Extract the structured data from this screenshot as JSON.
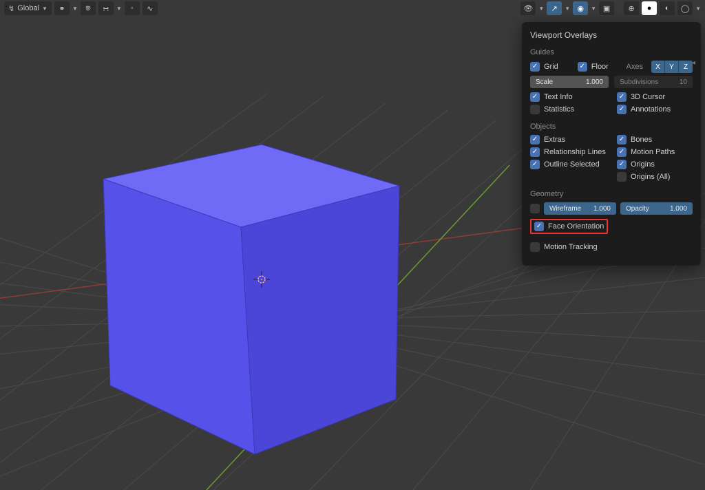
{
  "header": {
    "orientation_label": "Global",
    "snap_icons": [
      "link-icon",
      "magnet-icon",
      "proportional-icon",
      "pivot-icon",
      "curve-icon"
    ]
  },
  "header_right": {
    "buttons": [
      "visibility-icon",
      "gizmo-icon",
      "overlays-icon",
      "toggle-xray-icon",
      "shading-wire-icon",
      "shading-solid-icon",
      "shading-matprev-icon",
      "shading-rendered-icon"
    ]
  },
  "popover": {
    "title": "Viewport Overlays",
    "guides": {
      "header": "Guides",
      "grid": {
        "label": "Grid",
        "checked": true
      },
      "floor": {
        "label": "Floor",
        "checked": true
      },
      "axes_label": "Axes",
      "axes": [
        "X",
        "Y",
        "Z"
      ],
      "scale": {
        "label": "Scale",
        "value": "1.000"
      },
      "subdivisions": {
        "label": "Subdivisions",
        "value": "10"
      },
      "text_info": {
        "label": "Text Info",
        "checked": true
      },
      "cursor_3d": {
        "label": "3D Cursor",
        "checked": true
      },
      "statistics": {
        "label": "Statistics",
        "checked": false
      },
      "annotations": {
        "label": "Annotations",
        "checked": true
      }
    },
    "objects": {
      "header": "Objects",
      "extras": {
        "label": "Extras",
        "checked": true
      },
      "bones": {
        "label": "Bones",
        "checked": true
      },
      "relationship": {
        "label": "Relationship Lines",
        "checked": true
      },
      "motion_paths": {
        "label": "Motion Paths",
        "checked": true
      },
      "outline": {
        "label": "Outline Selected",
        "checked": true
      },
      "origins": {
        "label": "Origins",
        "checked": true
      },
      "origins_all": {
        "label": "Origins (All)",
        "checked": false
      }
    },
    "geometry": {
      "header": "Geometry",
      "wireframe": {
        "label": "Wireframe",
        "value": "1.000",
        "checked": false
      },
      "opacity": {
        "label": "Opacity",
        "value": "1.000"
      },
      "face_orientation": {
        "label": "Face Orientation",
        "checked": true
      }
    },
    "motion_tracking": {
      "label": "Motion Tracking",
      "checked": false
    }
  },
  "scene": {
    "object": "cube",
    "face_orientation_color": "#5b57f0",
    "grid_color": "#4a4a4a",
    "axis_x_color": "#a8403a",
    "axis_y_color": "#5e8c2e"
  }
}
